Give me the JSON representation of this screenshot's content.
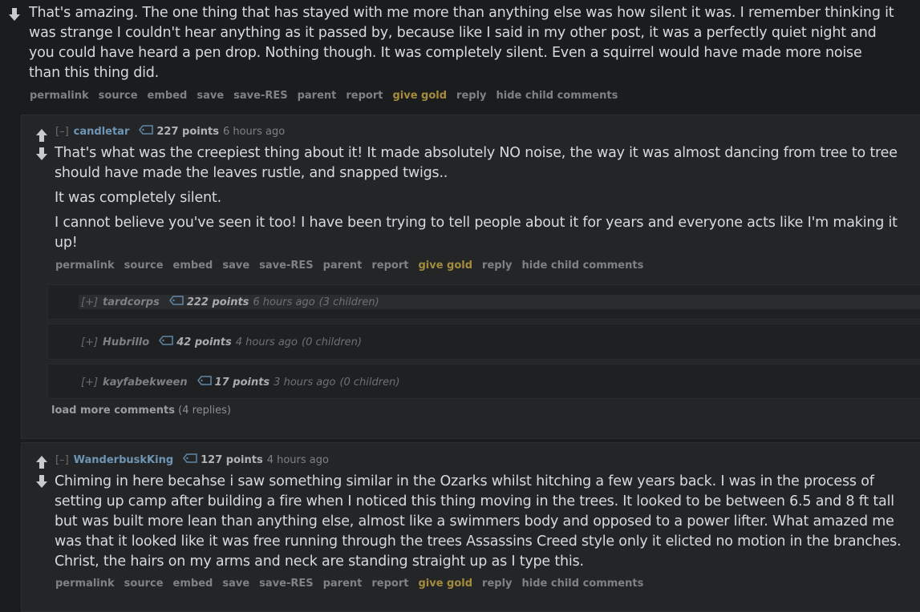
{
  "top_comment": {
    "text": "That's amazing. The one thing that has stayed with me more than anything else was how silent it was. I remember thinking it was strange I couldn't hear anything as it passed by, because like I said in my other post, it was a perfectly quiet night and you could have heard a pen drop. Nothing though. It was completely silent. Even a squirrel would have made more noise than this thing did."
  },
  "buttons": {
    "permalink": "permalink",
    "source": "source",
    "embed": "embed",
    "save": "save",
    "save_res": "save-RES",
    "parent": "parent",
    "report": "report",
    "give_gold": "give gold",
    "reply": "reply",
    "hide_child": "hide child comments"
  },
  "comment_candletar": {
    "expand": "[–]",
    "author": "candletar",
    "score": "227 points",
    "time": "6 hours ago",
    "paragraphs": [
      "That's what was the creepiest thing about it! It made absolutely NO noise, the way it was almost dancing from tree to tree should have made the leaves rustle, and snapped twigs..",
      "It was completely silent.",
      "I cannot believe you've seen it too! I have been trying to tell people about it for years and everyone acts like I'm making it up!"
    ]
  },
  "collapsed_replies": [
    {
      "expand": "[+]",
      "author": "tardcorps",
      "score": "222 points",
      "time": "6 hours ago",
      "children": "(3 children)"
    },
    {
      "expand": "[+]",
      "author": "Hubrillo",
      "score": "42 points",
      "time": "4 hours ago",
      "children": "(0 children)"
    },
    {
      "expand": "[+]",
      "author": "kayfabekween",
      "score": "17 points",
      "time": "3 hours ago",
      "children": "(0 children)"
    }
  ],
  "load_more": {
    "label": "load more comments",
    "count": "(4 replies)"
  },
  "comment_wanderbusk": {
    "expand": "[–]",
    "author": "WanderbuskKing",
    "score": "127 points",
    "time": "4 hours ago",
    "text": "Chiming in here becahse i saw something similar in the Ozarks whilst hitching a few years back. I was in the process of setting up camp after building a fire when I noticed this thing moving in the trees. It looked to be between 6.5 and 8 ft tall but was built more lean than anything else, almost like a swimmers body and opposed to a power lifter. What amazed me was that it looked like it was free running through the trees Assassins Creed style only it elicted no motion in the branches. Christ, the hairs on my arms and neck are standing straight up as I type this."
  }
}
